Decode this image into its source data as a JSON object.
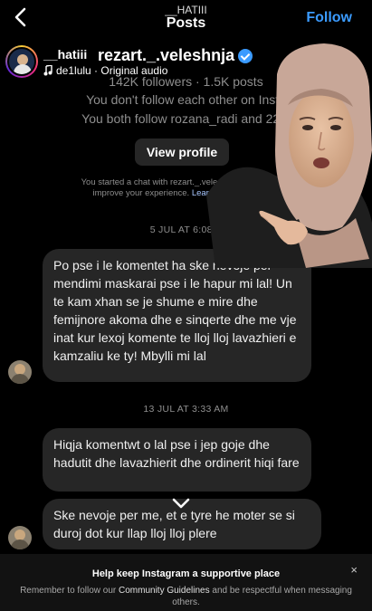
{
  "header": {
    "username": "__HATIII",
    "title": "Posts",
    "follow_label": "Follow"
  },
  "reel": {
    "username": "__hatiii",
    "audio": "de1lulu · Original audio",
    "more_icon": "more-horizontal-icon"
  },
  "chat_profile": {
    "name": "rezart._.veleshnja",
    "followers": "142K followers · 1.5K posts",
    "follow_status": "You don't follow each other on Insta",
    "mutual": "You both follow rozana_radi and 22 o",
    "view_profile_label": "View profile",
    "notice_text": "You started a chat with rezart._.veleshnja. We use infor",
    "notice_text2": "improve your experience.",
    "notice_link": "Learn about business r"
  },
  "messages": {
    "date1": "5 JUL AT 6:08 P",
    "msg1": "Po pse i le komentet ha ske nevoje per mendimi maskarai pse i le hapur mi lal! Un te kam xhan se je shume e mire dhe femijnore akoma dhe e sinqerte dhe me vje inat kur lexoj komente te lloj lloj lavazhieri e kamzaliu ke ty! Mbylli mi lal",
    "date2": "13 JUL AT 3:33 AM",
    "msg2": "Hiqja komentwt o lal pse i jep goje dhe hadutit dhe lavazhierit dhe ordinerit hiqi fare",
    "msg3": "Ske nevoje per me, et e tyre he moter se si duroj dot kur llap lloj lloj plere"
  },
  "banner": {
    "title": "Help keep Instagram a supportive place",
    "text_before": "Remember to follow our",
    "link": "Community Guidelines",
    "text_after": "and be respectful when messaging others.",
    "close": "×"
  },
  "colors": {
    "accent": "#3b9bff",
    "bubble": "#262626",
    "muted": "#8e8e8e"
  }
}
